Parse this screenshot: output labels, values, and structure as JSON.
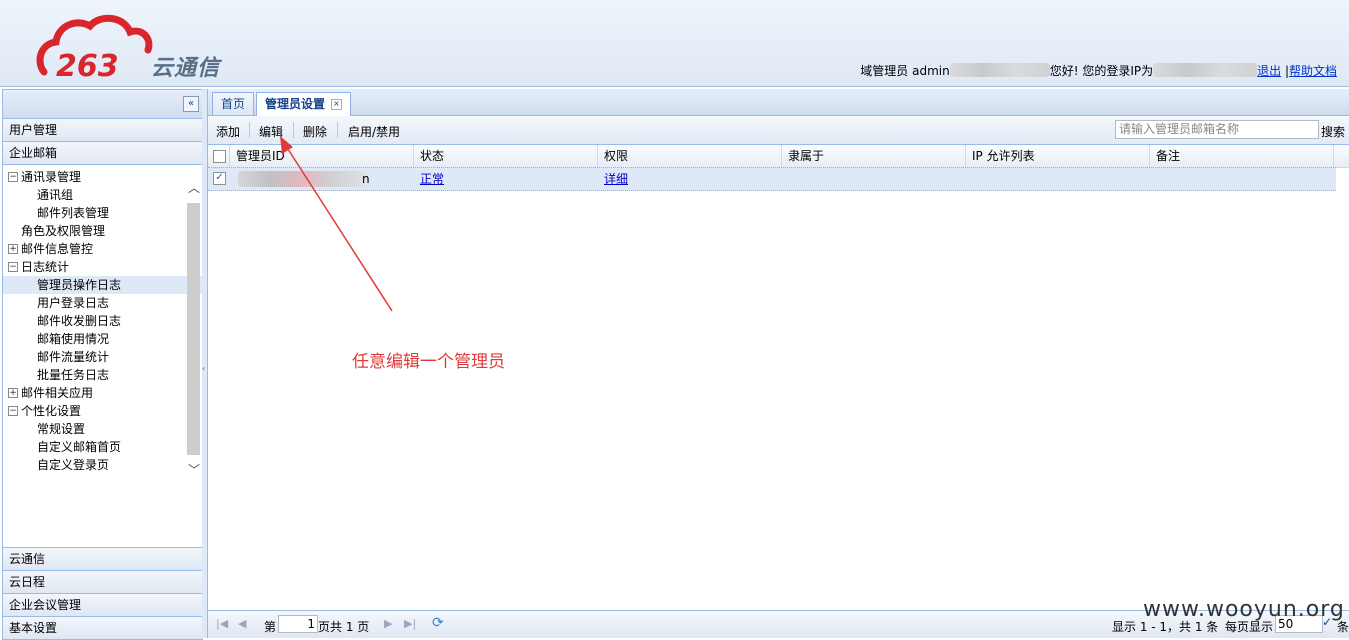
{
  "header": {
    "logo_text": "云通信",
    "user_prefix": "域管理员 admin",
    "greeting": "您好! 您的登录IP为",
    "logout": "退出",
    "help": "帮助文档"
  },
  "sidebar": {
    "collapse_icon": "double-chevron-left-icon",
    "sections_top": [
      "用户管理",
      "企业邮箱"
    ],
    "tree": [
      {
        "label": "通讯录管理",
        "level": 0,
        "toggle": "minus"
      },
      {
        "label": "通讯组",
        "level": 1
      },
      {
        "label": "邮件列表管理",
        "level": 1
      },
      {
        "label": "角色及权限管理",
        "level": 0,
        "toggle": ""
      },
      {
        "label": "邮件信息管控",
        "level": 0,
        "toggle": "plus"
      },
      {
        "label": "日志统计",
        "level": 0,
        "toggle": "minus"
      },
      {
        "label": "管理员操作日志",
        "level": 1,
        "selected": true
      },
      {
        "label": "用户登录日志",
        "level": 1
      },
      {
        "label": "邮件收发删日志",
        "level": 1
      },
      {
        "label": "邮箱使用情况",
        "level": 1
      },
      {
        "label": "邮件流量统计",
        "level": 1
      },
      {
        "label": "批量任务日志",
        "level": 1
      },
      {
        "label": "邮件相关应用",
        "level": 0,
        "toggle": "plus"
      },
      {
        "label": "个性化设置",
        "level": 0,
        "toggle": "minus"
      },
      {
        "label": "常规设置",
        "level": 1
      },
      {
        "label": "自定义邮箱首页",
        "level": 1
      },
      {
        "label": "自定义登录页",
        "level": 1
      }
    ],
    "sections_bottom": [
      "云通信",
      "云日程",
      "企业会议管理",
      "基本设置"
    ]
  },
  "tabs": [
    {
      "label": "首页",
      "active": false
    },
    {
      "label": "管理员设置",
      "active": true
    }
  ],
  "toolbar": {
    "add": "添加",
    "edit": "编辑",
    "delete": "删除",
    "toggle": "启用/禁用",
    "search_placeholder": "请输入管理员邮箱名称",
    "search": "搜索"
  },
  "grid": {
    "columns": [
      "管理员ID",
      "状态",
      "权限",
      "隶属于",
      "IP 允许列表",
      "备注"
    ],
    "rows": [
      {
        "checked": true,
        "id_suffix": "n",
        "status": "正常",
        "permission": "详细",
        "belongs": "",
        "ip": "",
        "note": ""
      }
    ]
  },
  "annotation": "任意编辑一个管理员",
  "pager": {
    "page_prefix": "第",
    "page": "1",
    "page_suffix": "页共 1 页",
    "display": "显示 1 - 1，共 1 条",
    "per_page_label": "每页显示",
    "per_page": "50",
    "tail": "条"
  },
  "watermark": "www.wooyun.org",
  "colors": {
    "accent": "#15428b",
    "border": "#99bbe8",
    "annotation": "#e03a3a",
    "logo": "#d9262c"
  }
}
